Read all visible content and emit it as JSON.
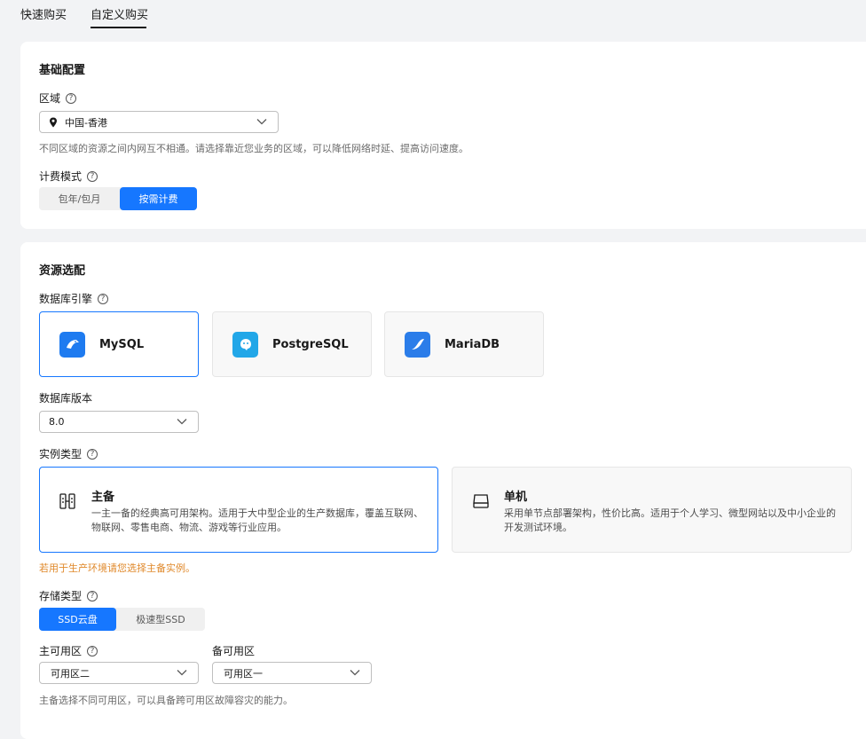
{
  "tabs": [
    "快速购买",
    "自定义购买"
  ],
  "basic": {
    "title": "基础配置",
    "region_label": "区域",
    "region_value": "中国-香港",
    "region_hint": "不同区域的资源之间内网互不相通。请选择靠近您业务的区域，可以降低网络时延、提高访问速度。",
    "billing_label": "计费模式",
    "billing_options": [
      "包年/包月",
      "按需计费"
    ],
    "billing_selected": "按需计费"
  },
  "resource": {
    "title": "资源选配",
    "engine_label": "数据库引擎",
    "engines": [
      "MySQL",
      "PostgreSQL",
      "MariaDB"
    ],
    "engine_selected": "MySQL",
    "version_label": "数据库版本",
    "version_value": "8.0",
    "instance_label": "实例类型",
    "instances": [
      {
        "title": "主备",
        "desc1": "一主一备的经典高可用架构。适用于大中型企业的生产数据库，覆盖互联网、",
        "desc2": "物联网、零售电商、物流、游戏等行业应用。"
      },
      {
        "title": "单机",
        "desc1": "采用单节点部署架构，性价比高。适用于个人学习、微型网站以及中小企业的",
        "desc2": "开发测试环境。"
      }
    ],
    "instance_warning": "若用于生产环境请您选择主备实例。",
    "storage_label": "存储类型",
    "storage_options": [
      "SSD云盘",
      "极速型SSD"
    ],
    "storage_selected": "SSD云盘",
    "primary_az_label": "主可用区",
    "primary_az_value": "可用区二",
    "standby_az_label": "备可用区",
    "standby_az_value": "可用区一",
    "az_hint": "主备选择不同可用区，可以具备跨可用区故障容灾的能力。"
  },
  "colors": {
    "accent": "#1677ff",
    "warning": "#e0892b",
    "mysql": "#1e7bf0",
    "postgres": "#22a7e8",
    "mariadb": "#2b7de9"
  },
  "icons": [
    "location-pin-icon",
    "chevron-down-icon",
    "help-icon",
    "mysql-logo-icon",
    "postgresql-logo-icon",
    "mariadb-logo-icon",
    "primary-standby-icon",
    "single-node-icon"
  ]
}
